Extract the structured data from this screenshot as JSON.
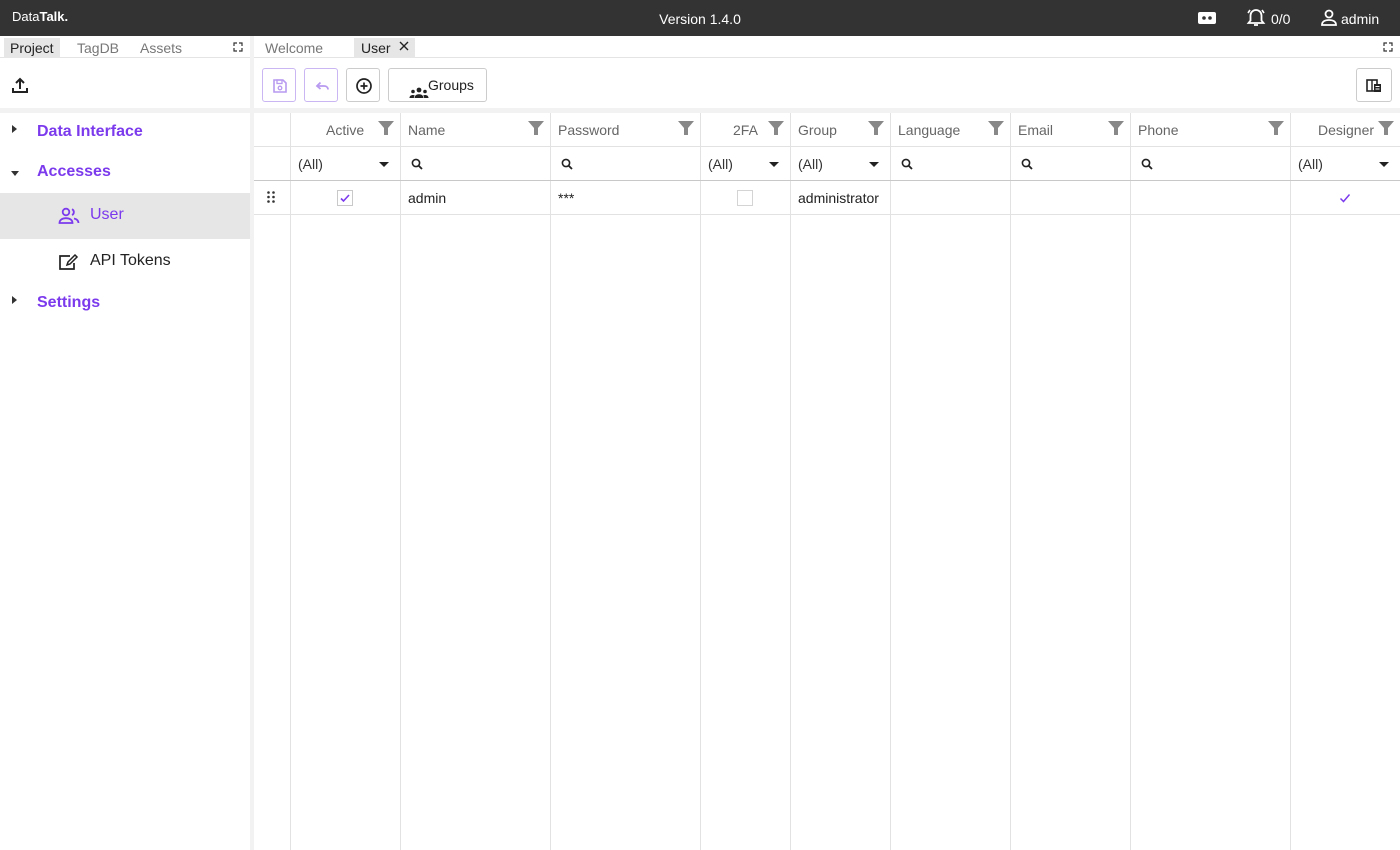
{
  "topbar": {
    "logo_prefix": "Data",
    "logo_bold": "Talk.",
    "version": "Version 1.4.0",
    "alarm_count": "0/0",
    "user": "admin",
    "icons": [
      "monitor-icon",
      "alarm-icon",
      "user-icon"
    ]
  },
  "left_panel": {
    "tabs": [
      {
        "label": "Project",
        "active": true
      },
      {
        "label": "TagDB",
        "active": false
      },
      {
        "label": "Assets",
        "active": false
      }
    ],
    "tree": [
      {
        "label": "Data Interface",
        "expanded": false
      },
      {
        "label": "Accesses",
        "expanded": true,
        "children": [
          {
            "label": "User",
            "icon": "users-icon",
            "selected": true
          },
          {
            "label": "API Tokens",
            "icon": "token-icon",
            "selected": false
          }
        ]
      },
      {
        "label": "Settings",
        "expanded": false
      }
    ]
  },
  "right_panel": {
    "tabs": [
      {
        "label": "Welcome",
        "active": false
      },
      {
        "label": "User",
        "active": true,
        "closable": true
      }
    ],
    "toolbar": {
      "save_icon": "save-icon",
      "undo_icon": "undo-icon",
      "add_icon": "add-circle-icon",
      "groups_label": "Groups",
      "columns_icon": "column-chooser-icon"
    }
  },
  "grid": {
    "columns": [
      "Active",
      "Name",
      "Password",
      "2FA",
      "Group",
      "Language",
      "Email",
      "Phone",
      "Designer"
    ],
    "filters": [
      "(All)",
      "",
      "",
      "(All)",
      "(All)",
      "",
      "",
      "",
      "(All)"
    ],
    "rows": [
      {
        "active": true,
        "name": "admin",
        "password": "***",
        "twofa": false,
        "group": "administrator",
        "language": "",
        "email": "",
        "phone": "",
        "designer": true
      }
    ],
    "accent": "#7c3aed"
  }
}
